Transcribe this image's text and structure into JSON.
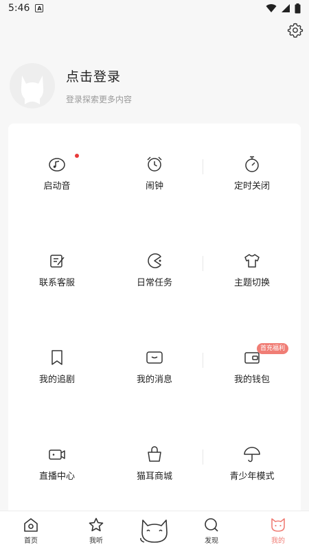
{
  "status": {
    "time": "5:46",
    "badge": "A"
  },
  "profile": {
    "title": "点击登录",
    "subtitle": "登录探索更多内容"
  },
  "grid": [
    {
      "label": "启动音",
      "icon": "music-note-icon"
    },
    {
      "label": "闹钟",
      "icon": "alarm-clock-icon"
    },
    {
      "label": "定时关闭",
      "icon": "timer-icon"
    },
    {
      "label": "联系客服",
      "icon": "edit-note-icon"
    },
    {
      "label": "日常任务",
      "icon": "pacman-icon"
    },
    {
      "label": "主题切换",
      "icon": "tshirt-icon"
    },
    {
      "label": "我的追剧",
      "icon": "bookmark-icon"
    },
    {
      "label": "我的消息",
      "icon": "message-icon"
    },
    {
      "label": "我的钱包",
      "icon": "wallet-icon"
    },
    {
      "label": "直播中心",
      "icon": "video-camera-icon"
    },
    {
      "label": "猫耳商城",
      "icon": "shopping-bag-icon"
    },
    {
      "label": "青少年模式",
      "icon": "umbrella-icon"
    }
  ],
  "promo_badge": "首充福利",
  "nav": [
    {
      "label": "首页",
      "icon": "home-icon"
    },
    {
      "label": "我听",
      "icon": "star-icon"
    },
    {
      "label": "发现",
      "icon": "search-icon"
    },
    {
      "label": "我的",
      "icon": "cat-face-icon"
    }
  ],
  "colors": {
    "accent": "#f07d75",
    "dot": "#e83a3a",
    "background": "#f7f7f7"
  }
}
